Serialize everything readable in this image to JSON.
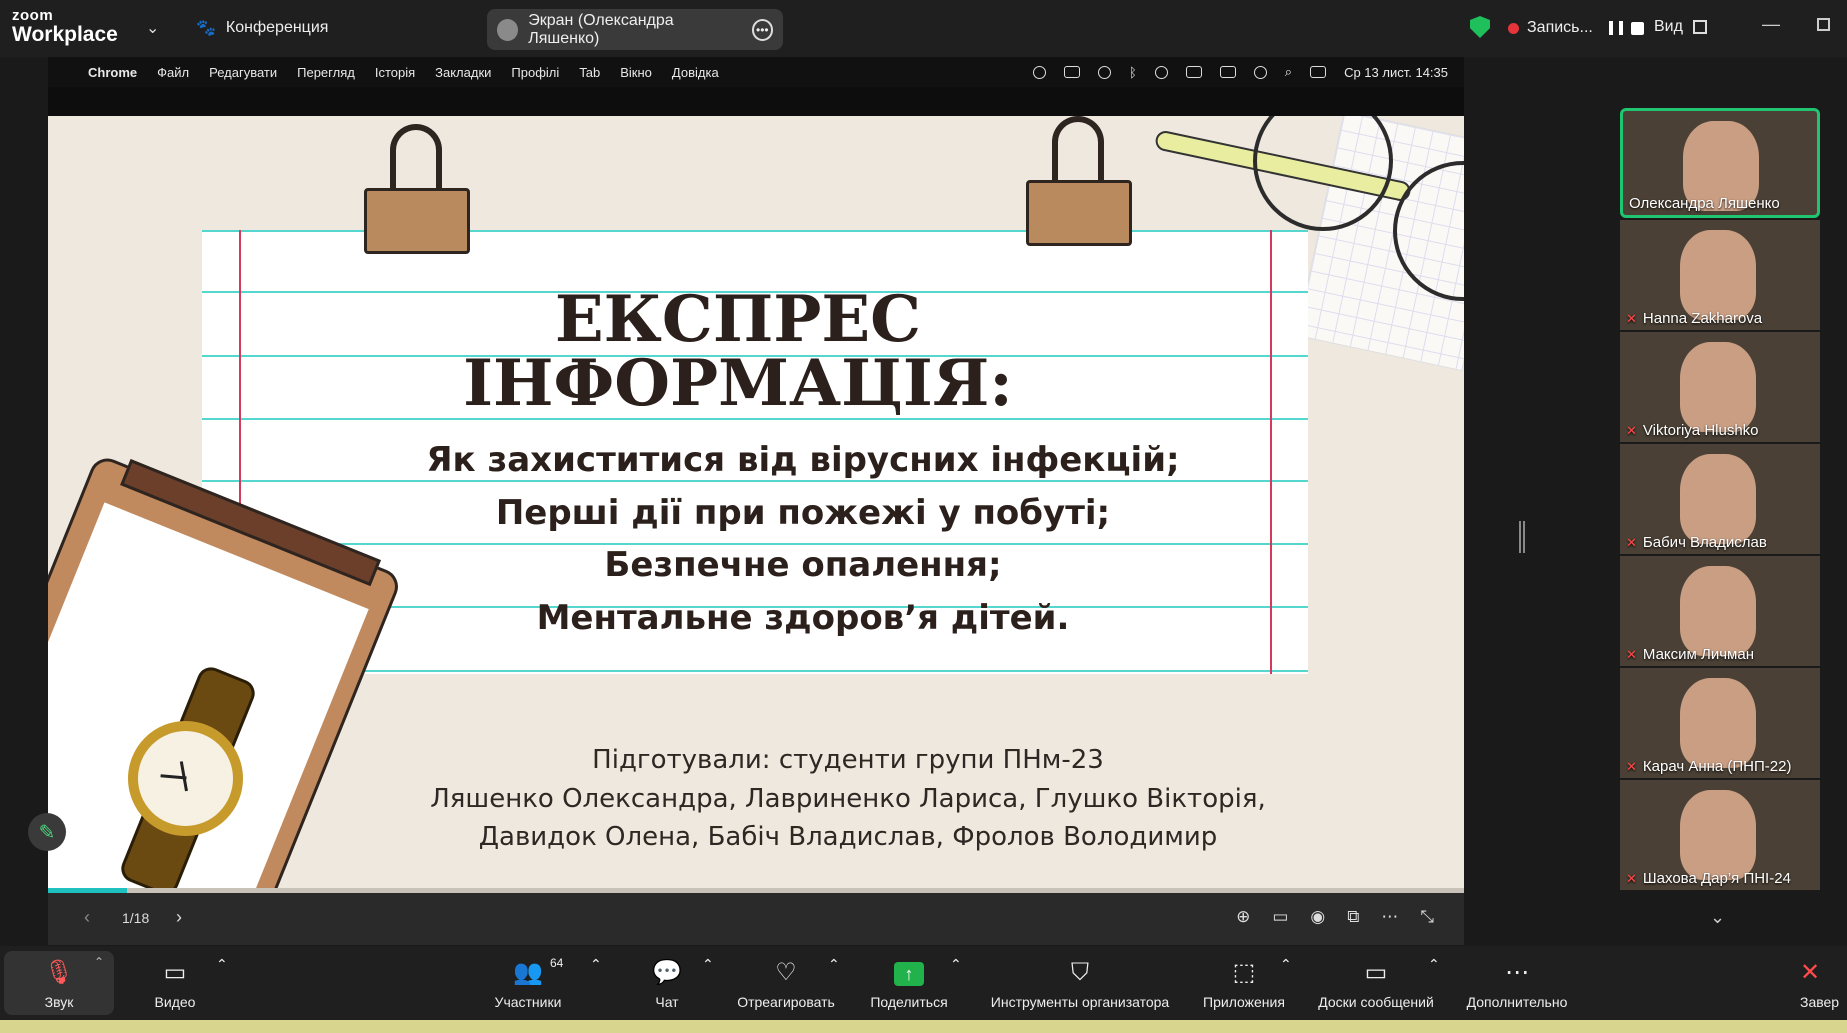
{
  "app": {
    "logo_small": "zoom",
    "logo_big": "Workplace"
  },
  "topbar": {
    "conference": "Конференция",
    "screen_label": "Экран (Олександра Ляшенко)",
    "record_label": "Запись...",
    "view_label": "Вид"
  },
  "mac_menu": {
    "items": [
      "Chrome",
      "Файл",
      "Редагувати",
      "Перегляд",
      "Історія",
      "Закладки",
      "Профілі",
      "Tab",
      "Вікно",
      "Довідка"
    ],
    "clock": "Ср 13 лист.  14:35"
  },
  "slide": {
    "title_line1": "ЕКСПРЕС",
    "title_line2": "ІНФОРМАЦІЯ:",
    "bullets": [
      "Як захиститися від вірусних інфекцій;",
      "Перші дії при пожежі у побуті;",
      "Безпечне опалення;",
      "Ментальне здоров’я дітей."
    ],
    "credits": [
      "Підготували: студенти групи ПНм-23",
      "Ляшенко Олександра, Лавриненко Лариса, Глушко Вікторія,",
      "Давидок Олена, Бабіч Владислав, Фролов Володимир"
    ],
    "page": "1/18",
    "progress_fraction": 0.056
  },
  "participants": [
    {
      "name": "Олександра Ляшенко",
      "muted": false,
      "active": true
    },
    {
      "name": "Hanna Zakharova",
      "muted": true
    },
    {
      "name": "Viktoriya Hlushko",
      "muted": true
    },
    {
      "name": "Бабич Владислав",
      "muted": true
    },
    {
      "name": "Максим Личман",
      "muted": true
    },
    {
      "name": "Карач Анна (ПНП-22)",
      "muted": true
    },
    {
      "name": "Шахова Дар’я ПНІ-24",
      "muted": true
    }
  ],
  "toolbar": {
    "audio": "Звук",
    "video": "Видео",
    "participants": "Участники",
    "participants_count": "64",
    "chat": "Чат",
    "react": "Отреагировать",
    "share": "Поделиться",
    "host_tools": "Инструменты организатора",
    "apps": "Приложения",
    "whiteboards": "Доски сообщений",
    "more": "Дополнительно",
    "end": "Завер"
  },
  "colors": {
    "accent_green": "#1fc56f",
    "share_green": "#21b24b",
    "rec_red": "#e5353a",
    "rule_teal": "#55d6cf"
  }
}
